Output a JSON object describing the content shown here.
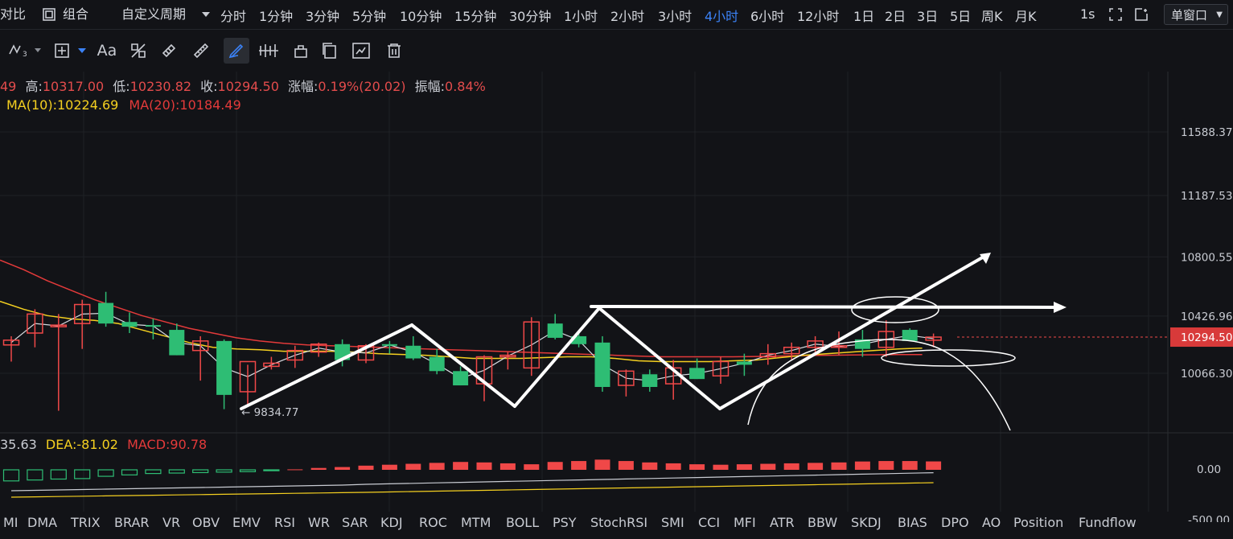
{
  "topbar": {
    "compare_label": "对比",
    "combo_label": "组合",
    "custom_period_label": "自定义周期",
    "periods": [
      "分时",
      "1分钟",
      "3分钟",
      "5分钟",
      "10分钟",
      "15分钟",
      "30分钟",
      "1小时",
      "2小时",
      "3小时",
      "4小时",
      "6小时",
      "12小时",
      "1日",
      "2日",
      "3日",
      "5日",
      "周K",
      "月K"
    ],
    "active_period": "4小时",
    "interval_label": "1s",
    "window_select": "单窗口"
  },
  "toolbar": {
    "icons": [
      "indicator-icon",
      "layout-icon",
      "text-icon",
      "pattern-icon",
      "magnet-icon",
      "ruler-icon",
      "pen-icon",
      "order-icon",
      "lock-icon",
      "copy-icon",
      "screenshot-icon",
      "delete-icon"
    ],
    "text_label": "Aa"
  },
  "ohlc": {
    "open_partial": "49",
    "high_label": "高:",
    "high": "10317.00",
    "low_label": "低:",
    "low": "10230.82",
    "close_label": "收:",
    "close": "10294.50",
    "change_label": "涨幅:",
    "change": "0.19%(20.02)",
    "amp_label": "振幅:",
    "amp": "0.84%"
  },
  "ma": {
    "ma10_label": "MA(10):",
    "ma10": "10224.69",
    "ma20_label": "MA(20):",
    "ma20": "10184.49"
  },
  "macd": {
    "dif_partial": "35.63",
    "dea_label": "DEA:",
    "dea": "-81.02",
    "macd_label": "MACD:",
    "macd": "90.78"
  },
  "chart_data": {
    "type": "candlestick",
    "price_axis_ticks": [
      11588.37,
      11187.53,
      10800.55,
      10426.96,
      10066.3
    ],
    "price_axis_labels": [
      "11588.37",
      "11187.53",
      "10800.55",
      "10426.96",
      "10066.30"
    ],
    "current_price": 10294.5,
    "current_price_label": "10294.50",
    "low_annotation": "← 9834.77",
    "candles": [
      {
        "o": 10245,
        "h": 10300,
        "l": 10140,
        "c": 10275
      },
      {
        "o": 10320,
        "h": 10470,
        "l": 10230,
        "c": 10440
      },
      {
        "o": 10360,
        "h": 10440,
        "l": 9830,
        "c": 10370
      },
      {
        "o": 10380,
        "h": 10530,
        "l": 10220,
        "c": 10500
      },
      {
        "o": 10510,
        "h": 10580,
        "l": 10360,
        "c": 10380
      },
      {
        "o": 10390,
        "h": 10450,
        "l": 10320,
        "c": 10360
      },
      {
        "o": 10370,
        "h": 10410,
        "l": 10280,
        "c": 10360
      },
      {
        "o": 10340,
        "h": 10380,
        "l": 10180,
        "c": 10180
      },
      {
        "o": 10210,
        "h": 10300,
        "l": 10020,
        "c": 10270
      },
      {
        "o": 10270,
        "h": 10280,
        "l": 9840,
        "c": 9930
      },
      {
        "o": 9950,
        "h": 10120,
        "l": 9870,
        "c": 10140
      },
      {
        "o": 10110,
        "h": 10170,
        "l": 10090,
        "c": 10130
      },
      {
        "o": 10150,
        "h": 10240,
        "l": 10100,
        "c": 10210
      },
      {
        "o": 10200,
        "h": 10260,
        "l": 10170,
        "c": 10250
      },
      {
        "o": 10250,
        "h": 10280,
        "l": 10110,
        "c": 10150
      },
      {
        "o": 10150,
        "h": 10250,
        "l": 10130,
        "c": 10240
      },
      {
        "o": 10250,
        "h": 10270,
        "l": 10190,
        "c": 10240
      },
      {
        "o": 10240,
        "h": 10300,
        "l": 10150,
        "c": 10160
      },
      {
        "o": 10170,
        "h": 10220,
        "l": 10060,
        "c": 10080
      },
      {
        "o": 10080,
        "h": 10110,
        "l": 9990,
        "c": 9990
      },
      {
        "o": 10000,
        "h": 10180,
        "l": 9890,
        "c": 10170
      },
      {
        "o": 10170,
        "h": 10200,
        "l": 10090,
        "c": 10180
      },
      {
        "o": 10100,
        "h": 10420,
        "l": 10050,
        "c": 10390
      },
      {
        "o": 10380,
        "h": 10440,
        "l": 10280,
        "c": 10290
      },
      {
        "o": 10300,
        "h": 10320,
        "l": 10230,
        "c": 10250
      },
      {
        "o": 10260,
        "h": 10300,
        "l": 9950,
        "c": 9980
      },
      {
        "o": 9990,
        "h": 10090,
        "l": 9920,
        "c": 10080
      },
      {
        "o": 10060,
        "h": 10090,
        "l": 9950,
        "c": 9980
      },
      {
        "o": 10000,
        "h": 10150,
        "l": 9900,
        "c": 10100
      },
      {
        "o": 10100,
        "h": 10160,
        "l": 10030,
        "c": 10030
      },
      {
        "o": 10050,
        "h": 10170,
        "l": 10000,
        "c": 10140
      },
      {
        "o": 10140,
        "h": 10190,
        "l": 10050,
        "c": 10120
      },
      {
        "o": 10170,
        "h": 10250,
        "l": 10120,
        "c": 10190
      },
      {
        "o": 10190,
        "h": 10260,
        "l": 10150,
        "c": 10230
      },
      {
        "o": 10230,
        "h": 10300,
        "l": 10200,
        "c": 10270
      },
      {
        "o": 10230,
        "h": 10330,
        "l": 10180,
        "c": 10240
      },
      {
        "o": 10280,
        "h": 10340,
        "l": 10170,
        "c": 10220
      },
      {
        "o": 10230,
        "h": 10400,
        "l": 10170,
        "c": 10330
      },
      {
        "o": 10340,
        "h": 10350,
        "l": 10270,
        "c": 10270
      },
      {
        "o": 10275,
        "h": 10317,
        "l": 10231,
        "c": 10294.5
      }
    ],
    "ma10_line": [
      10520,
      10470,
      10430,
      10410,
      10400,
      10380,
      10340,
      10300,
      10260,
      10230,
      10220,
      10215,
      10205,
      10205,
      10205,
      10200,
      10190,
      10185,
      10180,
      10170,
      10160,
      10160,
      10160,
      10165,
      10170,
      10170,
      10160,
      10145,
      10140,
      10140,
      10140,
      10145,
      10150,
      10165,
      10180,
      10190,
      10200,
      10210,
      10220,
      10225
    ],
    "ma20_line": [
      10780,
      10720,
      10650,
      10590,
      10530,
      10480,
      10430,
      10390,
      10350,
      10320,
      10290,
      10270,
      10255,
      10245,
      10240,
      10235,
      10230,
      10225,
      10220,
      10215,
      10210,
      10205,
      10200,
      10195,
      10190,
      10185,
      10180,
      10175,
      10170,
      10170,
      10170,
      10170,
      10172,
      10175,
      10178,
      10180,
      10182,
      10183,
      10184,
      10184
    ],
    "macd_histogram": [
      -120,
      -110,
      -100,
      -95,
      -70,
      -55,
      -40,
      -35,
      -30,
      -25,
      -20,
      -10,
      5,
      20,
      30,
      45,
      55,
      65,
      75,
      85,
      80,
      70,
      60,
      85,
      95,
      110,
      95,
      80,
      70,
      60,
      55,
      60,
      65,
      70,
      75,
      80,
      90,
      95,
      95,
      90.78
    ],
    "macd_axis_labels": [
      "0.00",
      "-500.00"
    ]
  },
  "footer": {
    "indicators": [
      "MI",
      "DMA",
      "TRIX",
      "BRAR",
      "VR",
      "OBV",
      "EMV",
      "RSI",
      "WR",
      "SAR",
      "KDJ",
      "ROC",
      "MTM",
      "BOLL",
      "PSY",
      "StochRSI",
      "SMI",
      "CCI",
      "MFI",
      "ATR",
      "BBW",
      "SKDJ",
      "BIAS",
      "DPO",
      "AO",
      "Position",
      "Fundflow"
    ]
  },
  "colors": {
    "up": "#f04848",
    "down": "#2ebd74",
    "ma10": "#f5d020",
    "ma20": "#e33a3a",
    "active": "#3b82f6",
    "background": "#121317"
  }
}
